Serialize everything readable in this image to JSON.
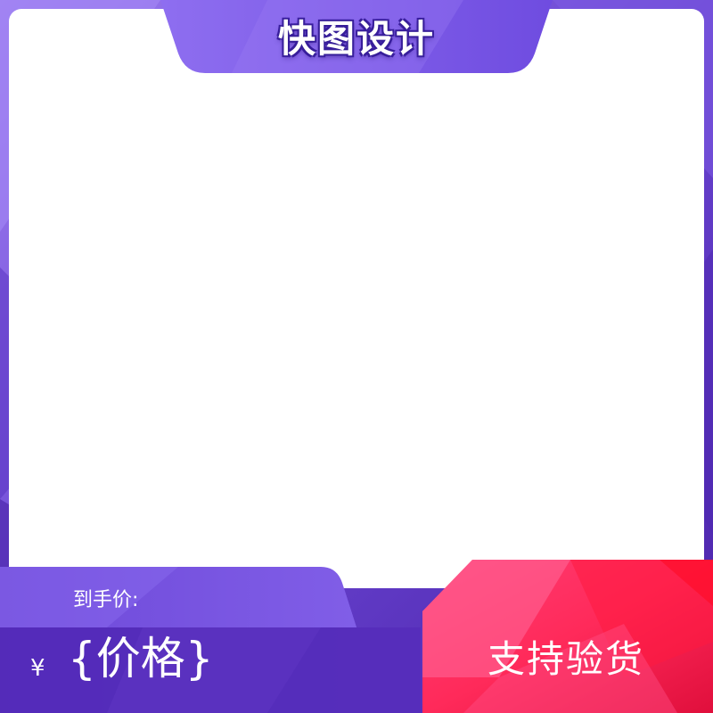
{
  "header": {
    "title": "快图设计"
  },
  "price": {
    "label": "到手价:",
    "currency": "¥",
    "value": "{价格}"
  },
  "badge": {
    "text": "支持验货"
  },
  "colors": {
    "purple_main": "#5a2fb8",
    "purple_light": "#8a66e8",
    "pink_red": "#ff2a5a",
    "white": "#ffffff"
  }
}
